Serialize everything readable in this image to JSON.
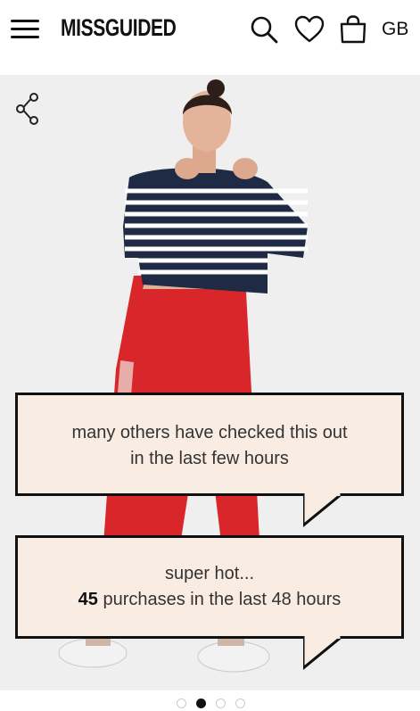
{
  "header": {
    "logo": "MISSGUIDED",
    "country": "GB",
    "icons": [
      "menu-icon",
      "search-icon",
      "heart-icon",
      "bag-icon"
    ]
  },
  "hero": {
    "share_icon": "share-icon",
    "notice_1": {
      "line1": "many others have checked this out",
      "line2": "in the last few hours"
    },
    "notice_2": {
      "line1": "super hot...",
      "count": "45",
      "line2_rest": " purchases in the last 48 hours"
    }
  },
  "carousel": {
    "total": 4,
    "active_index": 1
  },
  "colors": {
    "bubble_bg": "#f8ece3",
    "bubble_border": "#111111",
    "jeans": "#d8262b",
    "photo_bg": "#efefef"
  }
}
